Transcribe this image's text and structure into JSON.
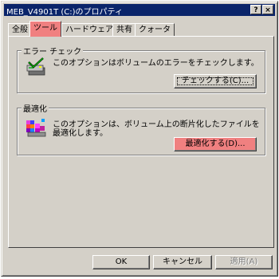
{
  "window": {
    "title": "MEB_V4901T (C:)のプロパティ",
    "help_button": "?",
    "close_button": "×"
  },
  "tabs": [
    {
      "label": "全般",
      "active": false
    },
    {
      "label": "ツール",
      "active": true
    },
    {
      "label": "ハードウェア",
      "active": false
    },
    {
      "label": "共有",
      "active": false
    },
    {
      "label": "クォータ",
      "active": false
    }
  ],
  "error_check": {
    "heading": "エラー チェック",
    "description": "このオプションはボリュームのエラーをチェックします。",
    "button_label": "チェックする(C)...",
    "icon": "check-disk-icon"
  },
  "optimize": {
    "heading": "最適化",
    "description_line1": "このオプションは、ボリューム上の断片化したファイルを",
    "description_line2": "最適化します。",
    "button_label": "最適化する(D)...",
    "icon": "defrag-icon"
  },
  "footer": {
    "ok_label": "OK",
    "cancel_label": "キャンセル",
    "apply_label": "適用(A)"
  },
  "colors": {
    "titlebar": "#0a246a",
    "highlight": "#f08080",
    "face": "#d4d0c8"
  }
}
